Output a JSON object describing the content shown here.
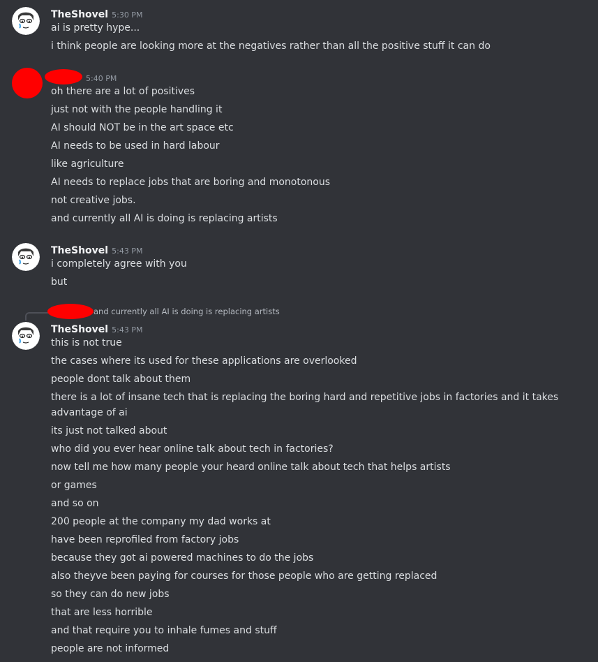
{
  "groups": [
    {
      "author": "TheShovel",
      "time": "5:30 PM",
      "messages": [
        "ai is pretty hype...",
        "i think people are looking more at the negatives rather than all the positive stuff it can do"
      ]
    },
    {
      "author": "",
      "time": "5:40 PM",
      "messages": [
        "oh there are a lot of positives",
        "just not with the people handling it",
        "AI should NOT be in the art space etc",
        "AI needs to be used in hard labour",
        "like agriculture",
        "AI needs to replace jobs that are boring and monotonous",
        "not creative jobs.",
        "and currently all AI is doing is replacing artists"
      ]
    },
    {
      "author": "TheShovel",
      "time": "5:43 PM",
      "messages": [
        "i completely agree with you",
        "but"
      ]
    },
    {
      "reply_preview": "and currently all AI is doing is replacing artists",
      "author": "TheShovel",
      "time": "5:43 PM",
      "messages": [
        "this is not true",
        "the cases where its used for these applications are overlooked",
        "people dont talk about them",
        "there is a lot of insane tech that is replacing the boring hard and repetitive jobs in factories and it takes advantage of ai",
        "its just not talked about",
        "who did you ever hear online talk about tech in factories?",
        "now tell me how many people your heard online talk about tech that helps artists",
        "or games",
        "and so on",
        "200 people at the company my dad works at",
        "have been reprofiled from factory jobs",
        "because they got ai powered machines to do the jobs",
        "also theyve been paying for courses for those people who are getting replaced",
        "so they can do new jobs",
        "that are less horrible",
        "and that require you to inhale fumes and stuff",
        "people are not informed"
      ]
    }
  ],
  "colors": {
    "background": "#313338",
    "redaction": "#ff0000",
    "username": "#f2f3f5",
    "text": "#dbdee1",
    "timestamp": "#949ba4"
  },
  "icons": {
    "avatar_theshovel": "cartoon-face-avatar-icon"
  }
}
